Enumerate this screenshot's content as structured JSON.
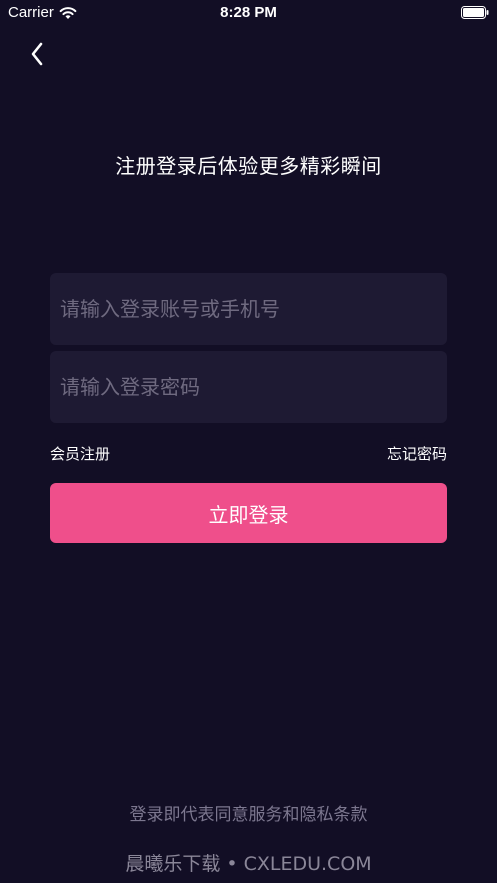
{
  "status_bar": {
    "carrier": "Carrier",
    "time": "8:28 PM",
    "icons": [
      "wifi-icon",
      "battery-icon"
    ]
  },
  "nav": {
    "back_icon": "chevron-left-icon"
  },
  "headline": "注册登录后体验更多精彩瞬间",
  "form": {
    "account_placeholder": "请输入登录账号或手机号",
    "account_value": "",
    "password_placeholder": "请输入登录密码",
    "password_value": ""
  },
  "links": {
    "register": "会员注册",
    "forgot_password": "忘记密码"
  },
  "login_button": "立即登录",
  "terms": "登录即代表同意服务和隐私条款",
  "watermark": "晨曦乐下载 • CXLEDU.COM",
  "colors": {
    "background": "#120e25",
    "field": "#1e1a33",
    "accent": "#ef4f8b"
  }
}
